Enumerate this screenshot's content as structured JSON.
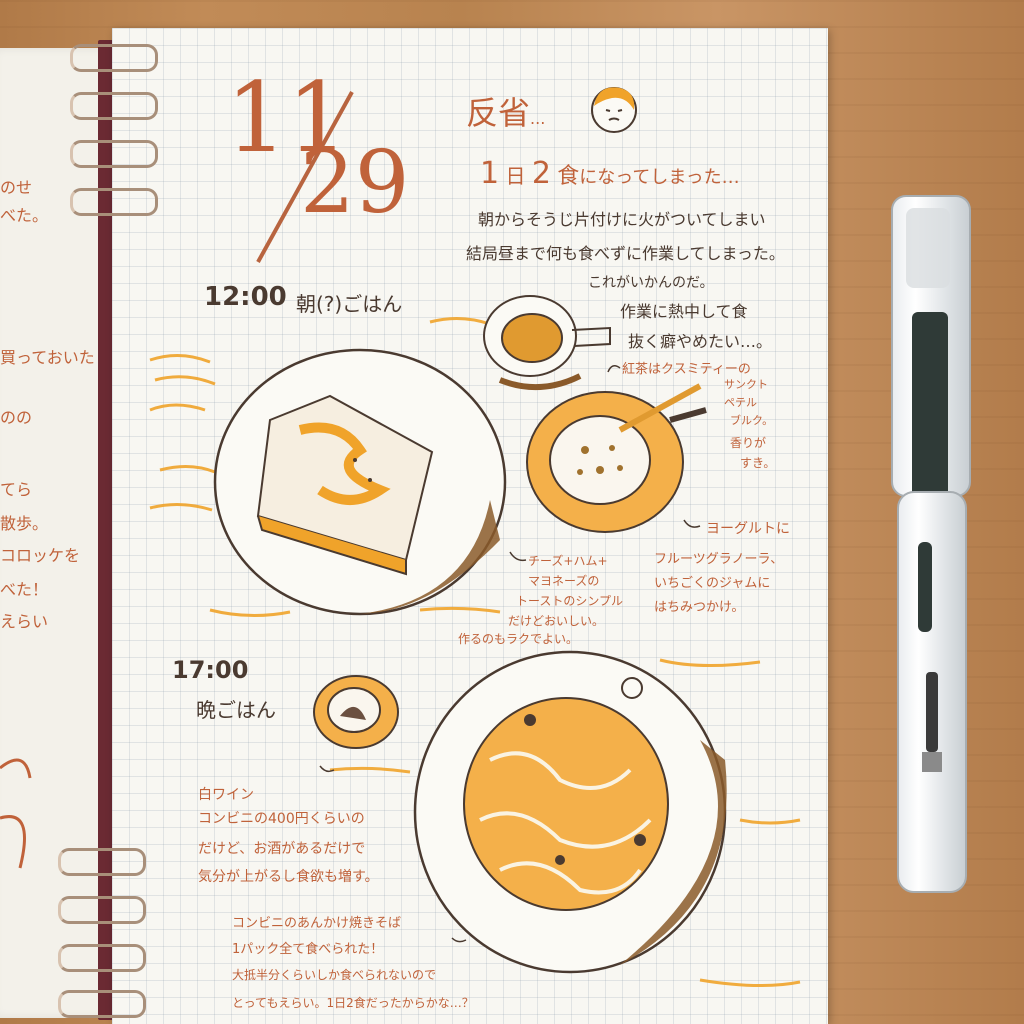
{
  "date": {
    "month": "11",
    "day": "29"
  },
  "heading": {
    "title": "反省",
    "ellipsis": "..."
  },
  "subtitle": {
    "one": "1",
    "one_unit": "日",
    "two": "2",
    "two_unit": "食",
    "rest": "になってしまった…"
  },
  "intro": {
    "lines": [
      "朝からそうじ片付けに火がついてしまい",
      "結局昼まで何も食べずに作業してしまった。",
      "これがいかんのだ。",
      "作業に熱中して食",
      "抜く癖やめたい…。"
    ]
  },
  "breakfast": {
    "time": "12:00",
    "title": "朝(?)ごはん",
    "tea_note": [
      "紅茶はクスミティーの",
      "サンクト",
      "ペテル",
      "ブルク。",
      "香りが",
      "すき。"
    ],
    "yogurt_note": [
      "ヨーグルトに",
      "フルーツグラノーラ、",
      "いちごくのジャムに",
      "はちみつかけ。"
    ],
    "toast_note": [
      "チーズ+ハム+",
      "マヨネーズの",
      "トーストのシンプル",
      "だけどおいしい。",
      "作るのもラクでよい。"
    ]
  },
  "dinner": {
    "time": "17:00",
    "title": "晩ごはん",
    "wine_note": [
      "白ワイン",
      "コンビニの400円くらいの",
      "だけど、お酒があるだけで",
      "気分が上がるし食欲も増す。"
    ],
    "noodle_note": [
      "コンビニのあんかけ焼きそば",
      "1パック全て食べられた！",
      "大抵半分くらいしか食べられないので",
      "とってもえらい。1日2食だったからかな…？"
    ]
  },
  "left_page": {
    "lines": [
      "のせ",
      "べた。",
      "買っておいた",
      "のの",
      "てら",
      "散歩。",
      "コロッケを",
      "べた！",
      "えらい"
    ]
  },
  "icons": [
    "spiral-binding-ring-icon",
    "sad-face-icon",
    "fountain-pen-icon",
    "tea-cup-icon",
    "plate-icon"
  ],
  "colors": {
    "ink": "#4a3a30",
    "orange_ink": "#c0623a",
    "highlight": "#f0a32a",
    "paper": "#f8f7f2",
    "cover": "#6b2a33"
  }
}
